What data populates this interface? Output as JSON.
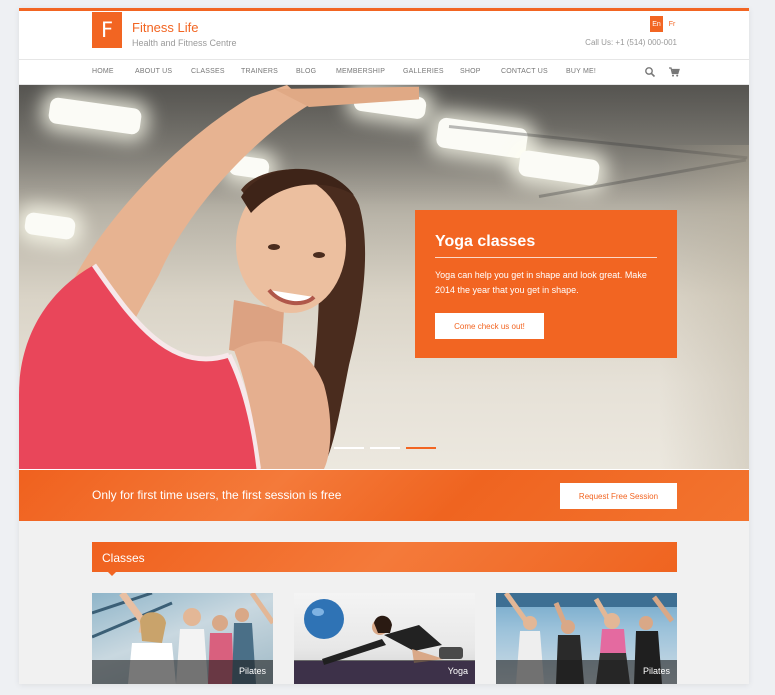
{
  "header": {
    "logo_letter": "F",
    "title": "Fitness Life",
    "tagline": "Health and Fitness Centre",
    "phone": "Call Us: +1 (514) 000-001",
    "languages": [
      "En",
      "Fr"
    ],
    "accent_color": "#f26522"
  },
  "nav": {
    "items": [
      "HOME",
      "ABOUT US",
      "CLASSES",
      "TRAINERS",
      "BLOG",
      "MEMBERSHIP",
      "GALLERIES",
      "SHOP",
      "CONTACT US",
      "BUY ME!"
    ],
    "icons": [
      "search-icon",
      "cart-icon"
    ]
  },
  "hero": {
    "slide_title": "Yoga classes",
    "slide_text": "Yoga can help you get in shape and look great. Make 2014 the year that you get in shape.",
    "button_label": "Come check us out!",
    "slides_total": 3,
    "active_slide": 3
  },
  "banner": {
    "text": "Only for first time users, the first session is free",
    "button_label": "Request Free Session"
  },
  "classes": {
    "title": "Classes",
    "cards": [
      {
        "label": "Pilates"
      },
      {
        "label": "Yoga"
      },
      {
        "label": "Pilates"
      }
    ]
  }
}
